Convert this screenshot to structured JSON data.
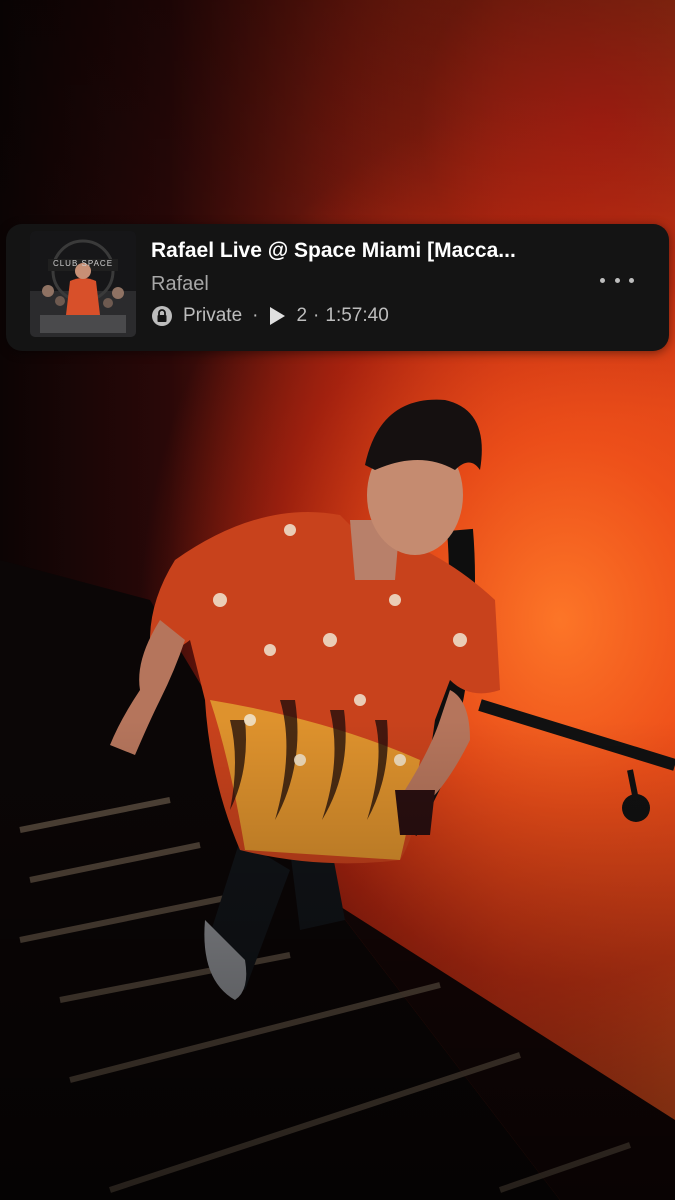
{
  "track": {
    "title": "Rafael Live @ Space Miami [Macca...",
    "artist": "Rafael",
    "privacy": "Private",
    "separator": "·",
    "play_count": "2",
    "duration": "1:57:40",
    "artwork_text": "CLUB SPACE"
  },
  "icons": {
    "privacy": "lock-icon",
    "plays": "play-icon",
    "menu": "more-options-icon"
  },
  "colors": {
    "card_background": "#141414",
    "title": "#ffffff",
    "secondary_text": "#a7a7a7",
    "wall_orange": "#e9561f"
  }
}
